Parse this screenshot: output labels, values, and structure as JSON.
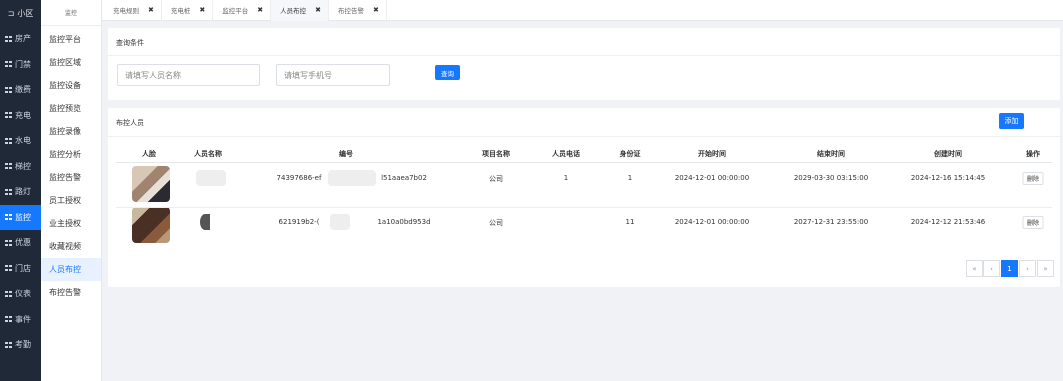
{
  "rail": {
    "top_label": "小区",
    "items": [
      {
        "label": "房产",
        "active": false
      },
      {
        "label": "门禁",
        "active": false
      },
      {
        "label": "缴费",
        "active": false
      },
      {
        "label": "充电",
        "active": false
      },
      {
        "label": "水电",
        "active": false
      },
      {
        "label": "梯控",
        "active": false
      },
      {
        "label": "路灯",
        "active": false
      },
      {
        "label": "监控",
        "active": true
      },
      {
        "label": "优惠",
        "active": false
      },
      {
        "label": "门店",
        "active": false
      },
      {
        "label": "仪表",
        "active": false
      },
      {
        "label": "事件",
        "active": false
      },
      {
        "label": "考勤",
        "active": false
      }
    ]
  },
  "submenu": {
    "header": "监控",
    "items": [
      {
        "label": "监控平台",
        "active": false
      },
      {
        "label": "监控区域",
        "active": false
      },
      {
        "label": "监控设备",
        "active": false
      },
      {
        "label": "监控预览",
        "active": false
      },
      {
        "label": "监控录像",
        "active": false
      },
      {
        "label": "监控分析",
        "active": false
      },
      {
        "label": "监控告警",
        "active": false
      },
      {
        "label": "员工授权",
        "active": false
      },
      {
        "label": "业主授权",
        "active": false
      },
      {
        "label": "收藏视频",
        "active": false
      },
      {
        "label": "人员布控",
        "active": true
      },
      {
        "label": "布控告警",
        "active": false
      }
    ]
  },
  "tabs": [
    {
      "label": "充电规则",
      "active": false
    },
    {
      "label": "充电桩",
      "active": false
    },
    {
      "label": "监控平台",
      "active": false
    },
    {
      "label": "人员布控",
      "active": true
    },
    {
      "label": "布控告警",
      "active": false
    }
  ],
  "query": {
    "title": "查询条件",
    "name_placeholder": "请填写人员名称",
    "phone_placeholder": "请填写手机号",
    "search_label": "查询"
  },
  "list": {
    "title": "布控人员",
    "add_label": "添加",
    "columns": [
      "人脸",
      "人员名称",
      "编号",
      "项目名称",
      "人员电话",
      "身份证",
      "开始时间",
      "结束时间",
      "创建时间",
      "操作"
    ],
    "rows": [
      {
        "name": "",
        "id_left": "74397686-ef",
        "id_right": "l51aaea7b02",
        "project": "公司",
        "phone": "1",
        "idcard": "1",
        "start": "2024-12-01 00:00:00",
        "end": "2029-03-30 03:15:00",
        "created": "2024-12-16 15:14:45",
        "action": "删除"
      },
      {
        "name": "",
        "id_left": "621919b2-(",
        "id_right": "1a10a0bd953d",
        "project": "公司",
        "phone": "",
        "idcard": "11",
        "start": "2024-12-01 00:00:00",
        "end": "2027-12-31 23:55:00",
        "created": "2024-12-12 21:53:46",
        "action": "删除"
      }
    ]
  },
  "pagination": {
    "first": "«",
    "prev": "‹",
    "current": "1",
    "next": "›",
    "last": "»"
  },
  "colors": {
    "accent": "#1677ff",
    "rail_bg": "#1f2937"
  }
}
